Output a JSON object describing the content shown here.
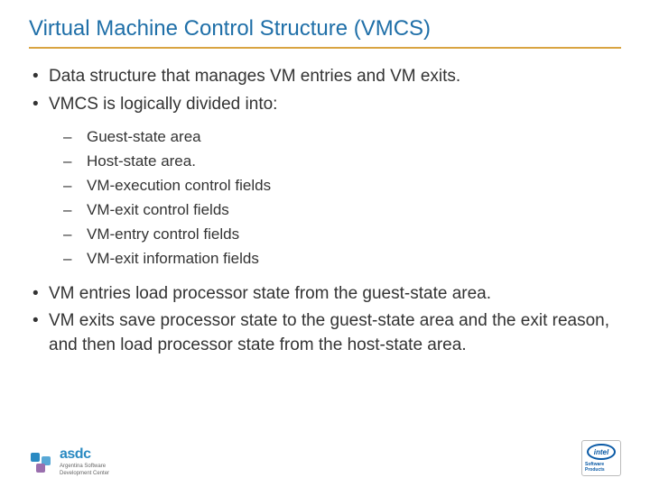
{
  "title": "Virtual Machine Control Structure (VMCS)",
  "bullets_top": [
    "Data structure that manages VM entries and VM exits.",
    "VMCS is logically divided into:"
  ],
  "sub_bullets": [
    "Guest-state area",
    "Host-state area.",
    "VM-execution control fields",
    "VM-exit control fields",
    "VM-entry control fields",
    "VM-exit information fields"
  ],
  "bullets_bottom": [
    "VM entries load processor state from the guest-state area.",
    "VM exits save processor state to the guest-state area and the exit reason, and then load processor state from the host-state area."
  ],
  "footer": {
    "asdc_name": "asdc",
    "asdc_sub1": "Argentina Software",
    "asdc_sub2": "Development Center",
    "intel_name": "intel",
    "intel_sub": "Software Products"
  }
}
